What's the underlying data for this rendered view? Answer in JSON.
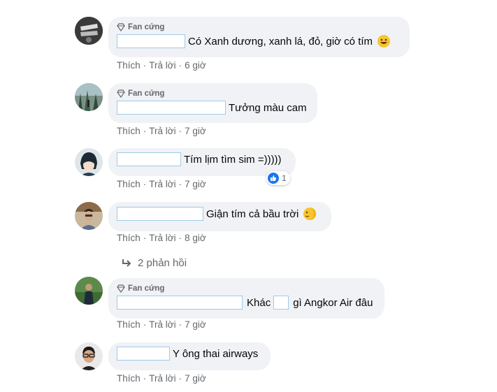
{
  "badge_label": "Fan cứng",
  "actions": {
    "like": "Thích",
    "reply": "Trả lời",
    "sep": "·"
  },
  "comments": [
    {
      "text": "Có Xanh dương, xanh lá, đỏ, giờ có tím",
      "time": "6 giờ"
    },
    {
      "text": "Tưởng màu cam",
      "time": "7 giờ"
    },
    {
      "text": "Tím lịm tìm sim =)))))",
      "time": "7 giờ",
      "reaction_count": "1"
    },
    {
      "text": "Giận tím cả bầu trời",
      "time": "8 giờ"
    },
    {
      "text_a": "Khác",
      "text_b": "gì Angkor Air đâu",
      "time": "7 giờ"
    },
    {
      "text": "Y ông thai airways",
      "time": "7 giờ"
    }
  ],
  "replies_label": "2 phản hồi",
  "colors": {
    "bubble": "#f0f2f5",
    "secondary_text": "#65676b",
    "like_blue": "#1877f2"
  }
}
